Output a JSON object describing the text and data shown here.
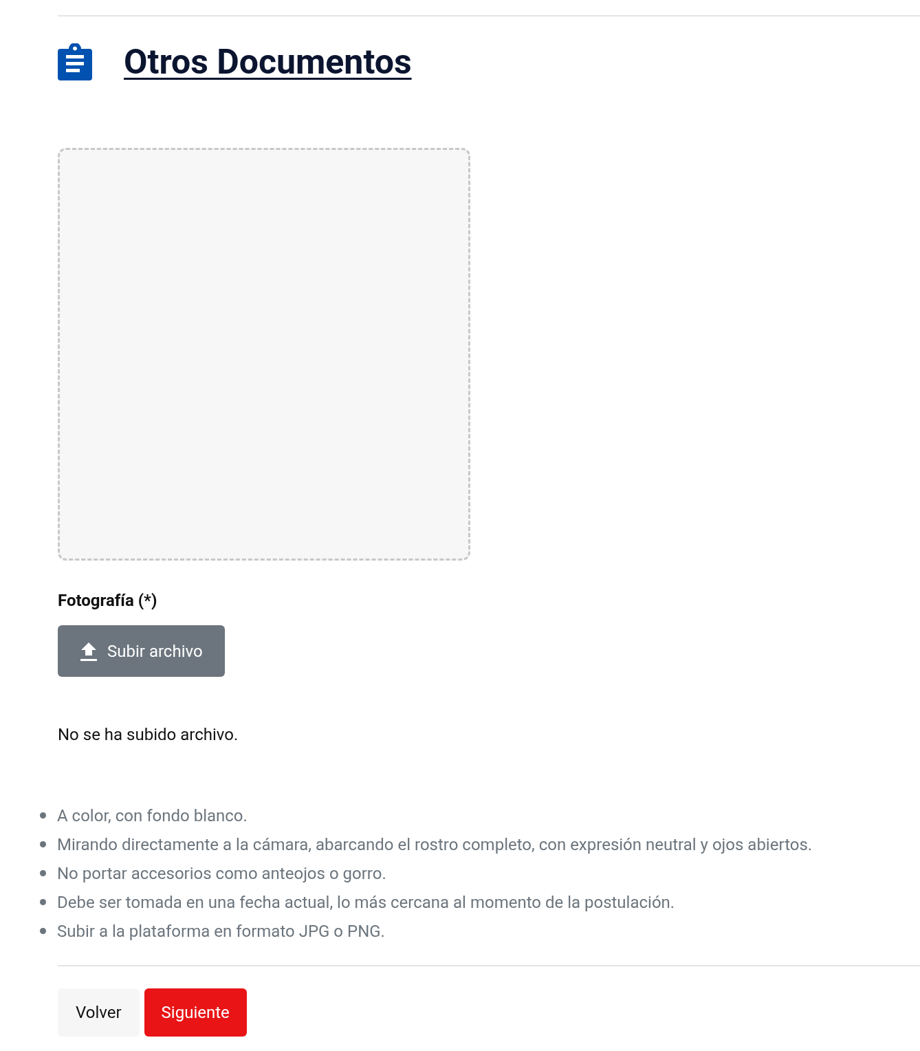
{
  "heading": "Otros Documentos",
  "upload": {
    "label": "Fotografía (*)",
    "button": "Subir archivo",
    "status": "No se ha subido archivo."
  },
  "requirements": [
    "A color, con fondo blanco.",
    "Mirando directamente a la cámara, abarcando el rostro completo, con expresión neutral y ojos abiertos.",
    "No portar accesorios como anteojos o gorro.",
    "Debe ser tomada en una fecha actual, lo más cercana al momento de la postulación.",
    "Subir a la plataforma en formato JPG o PNG."
  ],
  "buttons": [
    {
      "label": "Volver",
      "kind": "secondary"
    },
    {
      "label": "Siguiente",
      "kind": "primary"
    }
  ]
}
